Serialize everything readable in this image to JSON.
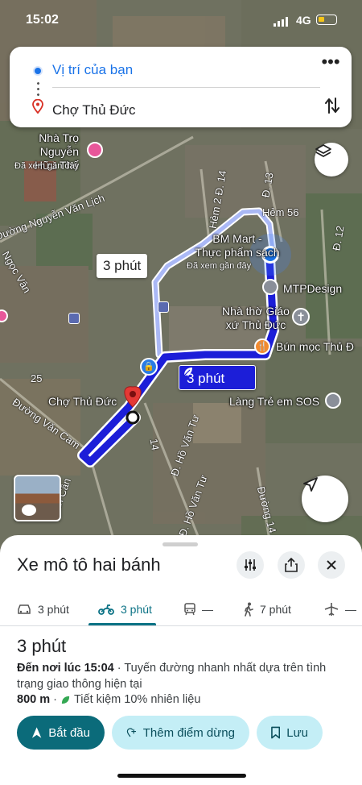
{
  "status_bar": {
    "time": "15:02",
    "network": "4G"
  },
  "search": {
    "origin": "Vị trí của bạn",
    "destination": "Chợ Thủ Đức",
    "more_label": "•••"
  },
  "map": {
    "places": [
      {
        "name": "Nhà Trọ Nguyễn\nHữu Thế",
        "sub": "Đã xem gần đây"
      },
      {
        "name": "BM Mart -\nThực phẩm sạch",
        "sub": "Đã xem gần đây"
      },
      {
        "name": "MTPDesign"
      },
      {
        "name": "Nhà thờ Giáo\nxứ Thủ Đức"
      },
      {
        "name": "Bún mọc Thủ Đ"
      },
      {
        "name": "Làng Trẻ em SOS"
      },
      {
        "name": "Chợ Thủ Đức"
      }
    ],
    "roads": [
      "Đường Nguyễn Văn Lịch",
      "Hẻm 2 Đ. 14",
      "Đ. 13",
      "Hẻm 56",
      "Đ. 12",
      "Ngọc Vân",
      "Đường Văn Cam",
      "25",
      "14",
      "Đ. Hồ Văn Tư",
      "Đ. Hồ Văn Tư",
      "Đường 14",
      "Văn Cần"
    ],
    "route_badge_alt": "3 phút",
    "route_badge_main": "3 phút"
  },
  "sheet": {
    "mode_title": "Xe mô tô hai bánh",
    "tabs": [
      {
        "icon": "car-icon",
        "label": "3 phút"
      },
      {
        "icon": "motorbike-icon",
        "label": "3 phút"
      },
      {
        "icon": "transit-icon",
        "label": "—"
      },
      {
        "icon": "walk-icon",
        "label": "7 phút"
      },
      {
        "icon": "flight-icon",
        "label": "—"
      }
    ],
    "duration": "3 phút",
    "arrival_prefix": "Đến nơi lúc 15:04",
    "arrival_rest": " · Tuyến đường nhanh nhất dựa trên tình trạng giao thông hiện tại",
    "distance": "800 m",
    "fuel": "Tiết kiệm 10% nhiên liệu",
    "buttons": {
      "start": "Bắt đầu",
      "add_stop": "Thêm điểm dừng",
      "save": "Lưu"
    }
  },
  "colors": {
    "route": "#1c1ed8",
    "alt_route": "#aab8f5",
    "accent": "#0b6b7a",
    "chip": "#c4eef6"
  }
}
